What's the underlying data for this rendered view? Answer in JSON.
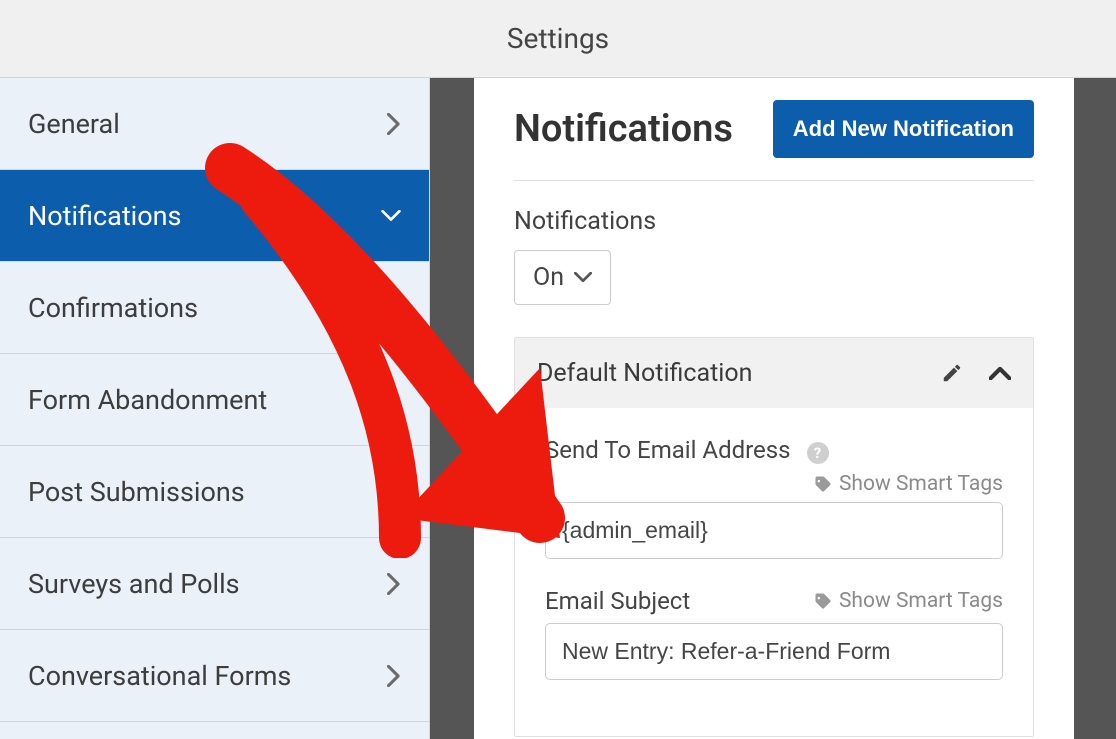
{
  "header": {
    "title": "Settings"
  },
  "sidebar": {
    "items": [
      {
        "label": "General"
      },
      {
        "label": "Notifications"
      },
      {
        "label": "Confirmations"
      },
      {
        "label": "Form Abandonment"
      },
      {
        "label": "Post Submissions"
      },
      {
        "label": "Surveys and Polls"
      },
      {
        "label": "Conversational Forms"
      }
    ]
  },
  "main": {
    "title": "Notifications",
    "add_button": "Add New Notification",
    "toggle_label": "Notifications",
    "toggle_value": "On",
    "panel": {
      "title": "Default Notification",
      "send_to_label": "Send To Email Address",
      "send_to_value": "{admin_email}",
      "subject_label": "Email Subject",
      "subject_value": "New Entry: Refer-a-Friend Form",
      "smart_tags": "Show Smart Tags"
    }
  }
}
